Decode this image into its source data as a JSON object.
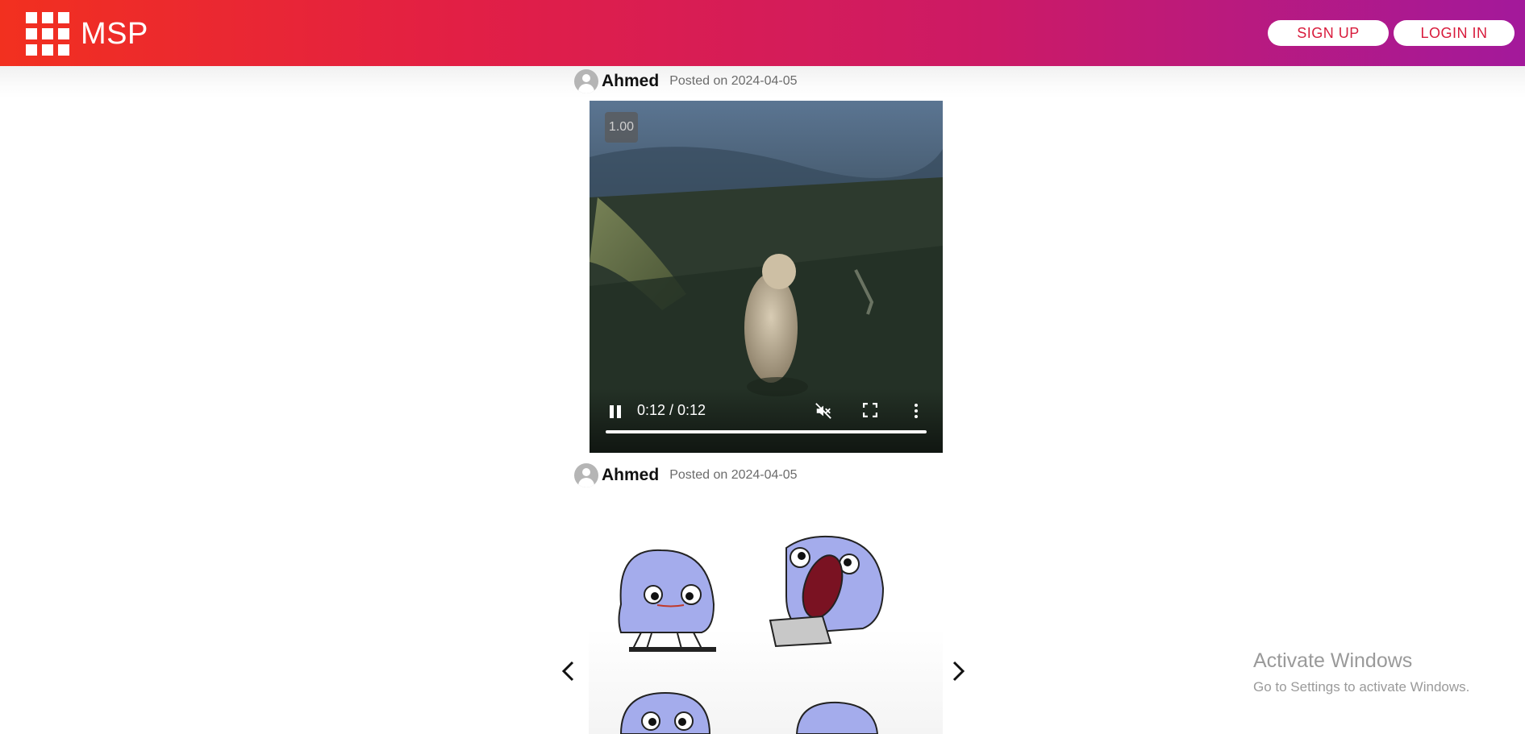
{
  "header": {
    "brand": "MSP",
    "signup_label": "SIGN UP",
    "login_label": "LOGIN IN",
    "colors": {
      "gradient_start": "#f2301f",
      "gradient_end": "#a3199b",
      "button_text": "#d81b3c"
    }
  },
  "posts": [
    {
      "author": "Ahmed",
      "date_text": "Posted on 2024-04-05",
      "media_type": "video",
      "video": {
        "speed_badge": "1.00",
        "time": "0:12 / 0:12",
        "progress": 1.0,
        "muted": true,
        "icons": [
          "pause-icon",
          "muted-speaker-icon",
          "fullscreen-icon",
          "more-vert-icon"
        ]
      }
    },
    {
      "author": "Ahmed",
      "date_text": "Posted on 2024-04-05",
      "media_type": "image-carousel",
      "icons": [
        "chevron-left-icon",
        "chevron-right-icon"
      ]
    }
  ],
  "watermark": {
    "title": "Activate Windows",
    "subtitle": "Go to Settings to activate Windows."
  }
}
